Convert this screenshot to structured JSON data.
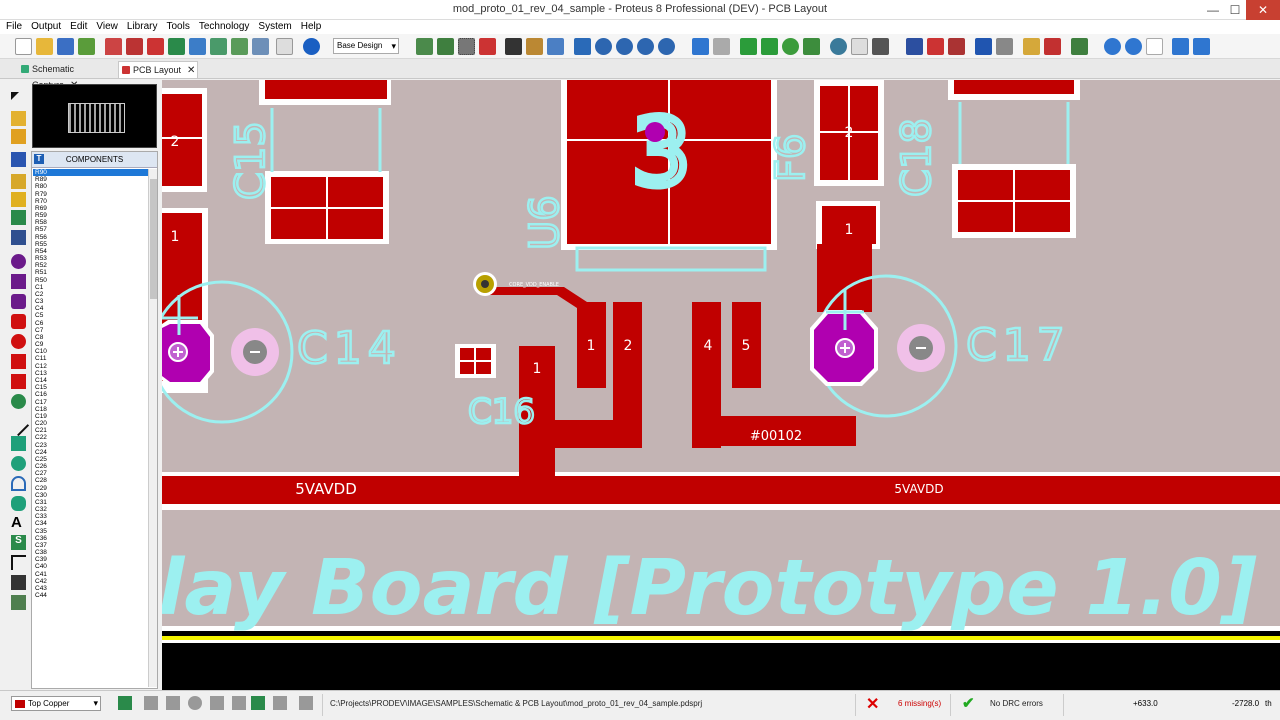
{
  "window": {
    "title": "mod_proto_01_rev_04_sample - Proteus 8 Professional (DEV) - PCB Layout",
    "minimize": "—",
    "maximize": "☐",
    "close": "✕"
  },
  "menu": [
    "File",
    "Output",
    "Edit",
    "View",
    "Library",
    "Tools",
    "Technology",
    "System",
    "Help"
  ],
  "toolbar": {
    "design_select": "Base Design"
  },
  "tabs": [
    {
      "label": "Schematic Capture",
      "close": "✕"
    },
    {
      "label": "PCB Layout",
      "close": "✕"
    }
  ],
  "components": {
    "header": "COMPONENTS",
    "header_icon": "T",
    "selected": "R90",
    "items": [
      "R90",
      "R89",
      "R80",
      "R79",
      "R70",
      "R69",
      "R59",
      "R58",
      "R57",
      "R56",
      "R55",
      "R54",
      "R53",
      "R52",
      "R51",
      "R50",
      "C1",
      "C2",
      "C3",
      "C4",
      "C5",
      "C6",
      "C7",
      "C8",
      "C9",
      "C10",
      "C11",
      "C12",
      "C13",
      "C14",
      "C15",
      "C16",
      "C17",
      "C18",
      "C19",
      "C20",
      "C21",
      "C22",
      "C23",
      "C24",
      "C25",
      "C26",
      "C27",
      "C28",
      "C29",
      "C30",
      "C31",
      "C32",
      "C33",
      "C34",
      "C35",
      "C36",
      "C37",
      "C38",
      "C39",
      "C40",
      "C41",
      "C42",
      "C43",
      "C44"
    ]
  },
  "pcb": {
    "silkscreen": {
      "c15": "C15",
      "c14": "C14",
      "c16": "C16",
      "c17": "C17",
      "c18": "C18",
      "f6": "F6",
      "u6": "U6",
      "u_pin": "3",
      "board_title": "lay Board [Prototype 1.0]"
    },
    "pads": {
      "left_pad": "1",
      "c16_pad": "1",
      "u6_pin1": "1",
      "u6_pin2": "2",
      "u6_pin4": "4",
      "u6_pin5": "5",
      "right_pad": "1",
      "c15_pad": "2",
      "f6_pad": "2"
    },
    "nets": {
      "power_left": "5VAVDD",
      "power_right": "5VAVDD",
      "net_00102": "#00102",
      "core_enable": "CORE_VDD_ENABLE"
    },
    "colors": {
      "background": "#c3b4b4",
      "top_copper": "#c00000",
      "silkscreen": "#9cf0f0",
      "via": "#b000b0"
    }
  },
  "status": {
    "layer": "Top Copper",
    "path": "C:\\Projects\\PRODEV\\IMAGE\\SAMPLES\\Schematic & PCB Layout\\mod_proto_01_rev_04_sample.pdsprj",
    "errors": "6 missing(s)",
    "drc": "No DRC errors",
    "coord_x": "+633.0",
    "coord_y": "-2728.0",
    "unit": "th"
  }
}
